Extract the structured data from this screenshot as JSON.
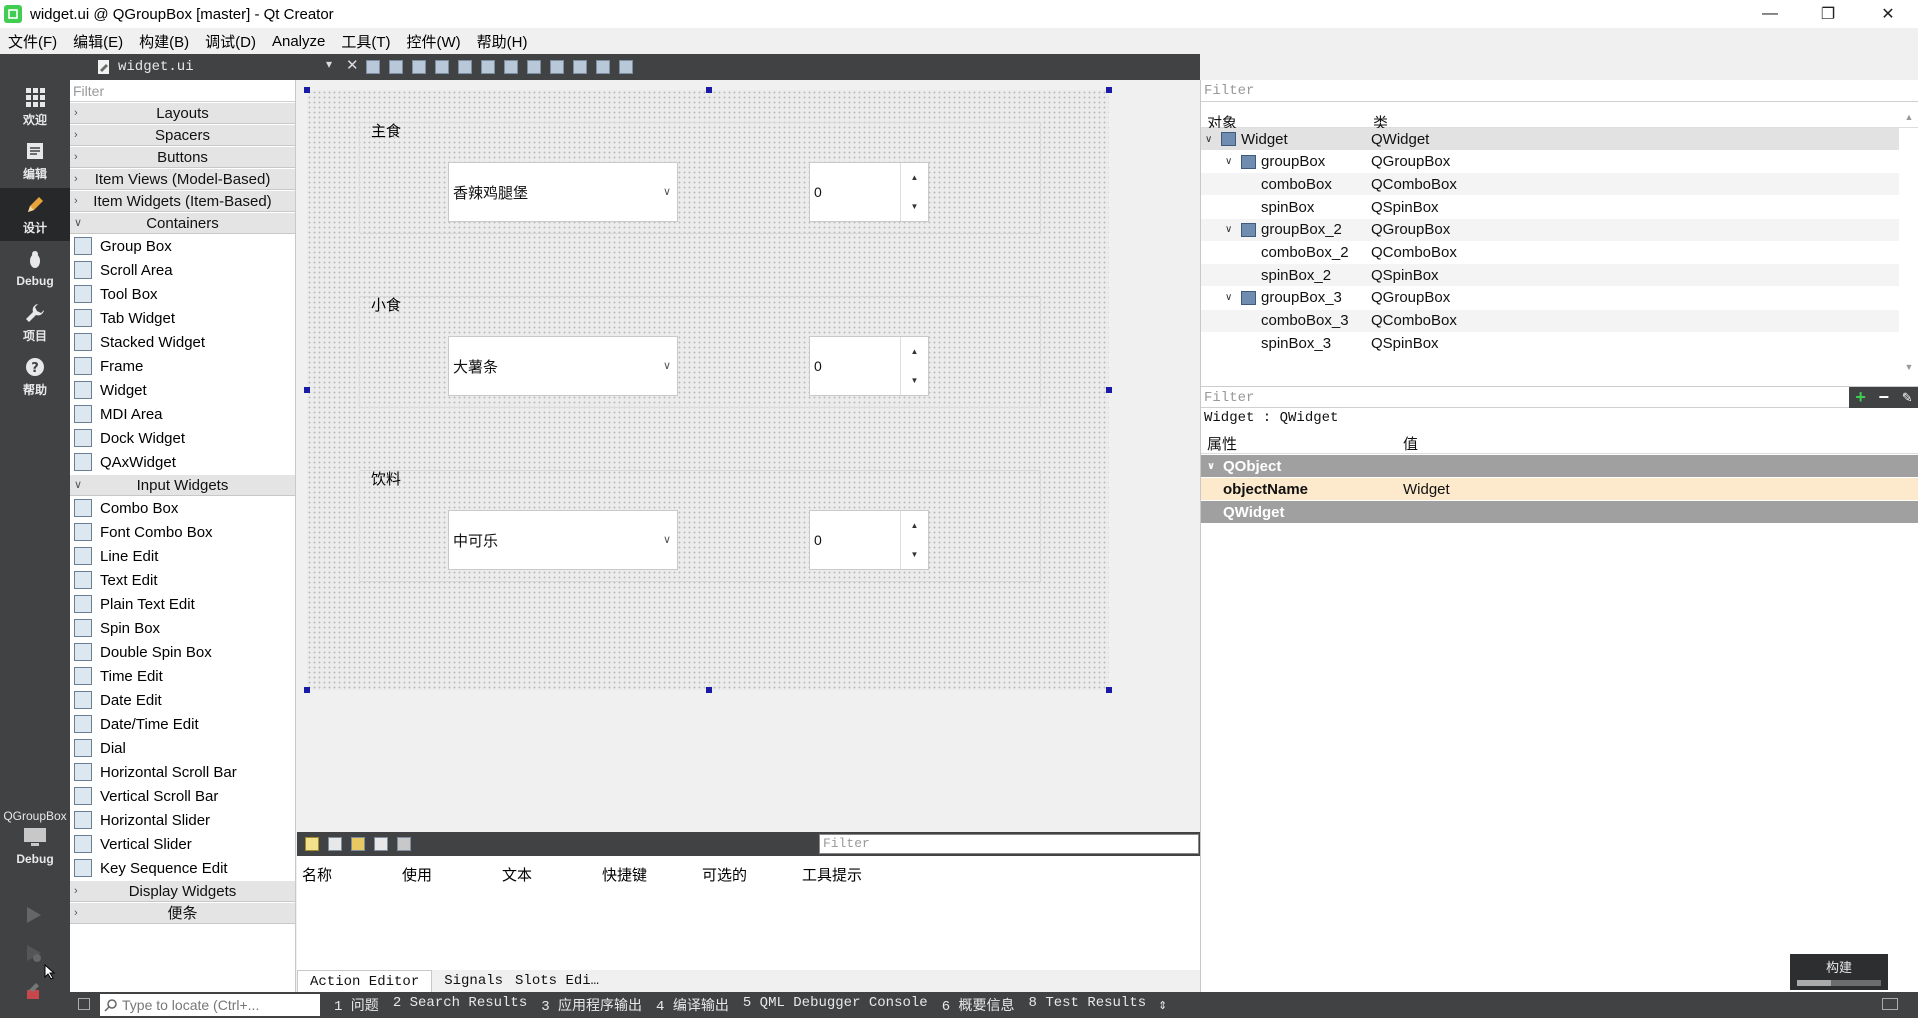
{
  "window": {
    "title": "widget.ui @ QGroupBox [master] - Qt Creator"
  },
  "menu": [
    "文件(F)",
    "编辑(E)",
    "构建(B)",
    "调试(D)",
    "Analyze",
    "工具(T)",
    "控件(W)",
    "帮助(H)"
  ],
  "modes": [
    {
      "label": "欢迎",
      "icon": "grid-icon"
    },
    {
      "label": "编辑",
      "icon": "edit-doc-icon"
    },
    {
      "label": "设计",
      "icon": "pencil-icon"
    },
    {
      "label": "Debug",
      "icon": "bug-icon"
    },
    {
      "label": "项目",
      "icon": "wrench-icon"
    },
    {
      "label": "帮助",
      "icon": "help-icon"
    }
  ],
  "kit": {
    "name": "QGroupBox",
    "mode": "Debug"
  },
  "editor": {
    "file": "widget.ui"
  },
  "widgetbox": {
    "filter_placeholder": "Filter",
    "categories": [
      {
        "name": "Layouts",
        "expanded": false,
        "items": []
      },
      {
        "name": "Spacers",
        "expanded": false,
        "items": []
      },
      {
        "name": "Buttons",
        "expanded": false,
        "items": []
      },
      {
        "name": "Item Views (Model-Based)",
        "expanded": false,
        "items": []
      },
      {
        "name": "Item Widgets (Item-Based)",
        "expanded": false,
        "items": []
      },
      {
        "name": "Containers",
        "expanded": true,
        "items": [
          "Group Box",
          "Scroll Area",
          "Tool Box",
          "Tab Widget",
          "Stacked Widget",
          "Frame",
          "Widget",
          "MDI Area",
          "Dock Widget",
          "QAxWidget"
        ]
      },
      {
        "name": "Input Widgets",
        "expanded": true,
        "items": [
          "Combo Box",
          "Font Combo Box",
          "Line Edit",
          "Text Edit",
          "Plain Text Edit",
          "Spin Box",
          "Double Spin Box",
          "Time Edit",
          "Date Edit",
          "Date/Time Edit",
          "Dial",
          "Horizontal Scroll Bar",
          "Vertical Scroll Bar",
          "Horizontal Slider",
          "Vertical Slider",
          "Key Sequence Edit"
        ]
      },
      {
        "name": "Display Widgets",
        "expanded": false,
        "items": []
      },
      {
        "name": "便条",
        "expanded": false,
        "items": []
      }
    ]
  },
  "form": {
    "groups": [
      {
        "title": "主食",
        "combo": "香辣鸡腿堡",
        "spin": "0"
      },
      {
        "title": "小食",
        "combo": "大薯条",
        "spin": "0"
      },
      {
        "title": "饮料",
        "combo": "中可乐",
        "spin": "0"
      }
    ]
  },
  "action_editor": {
    "filter_placeholder": "Filter",
    "columns": [
      "名称",
      "使用",
      "文本",
      "快捷键",
      "可选的",
      "工具提示"
    ],
    "tabs": [
      "Action Editor",
      "Signals",
      "Slots Edi…"
    ]
  },
  "object_inspector": {
    "filter_placeholder": "Filter",
    "columns": [
      "对象",
      "类"
    ],
    "rows": [
      {
        "name": "Widget",
        "class": "QWidget"
      },
      {
        "name": "groupBox",
        "class": "QGroupBox"
      },
      {
        "name": "comboBox",
        "class": "QComboBox"
      },
      {
        "name": "spinBox",
        "class": "QSpinBox"
      },
      {
        "name": "groupBox_2",
        "class": "QGroupBox"
      },
      {
        "name": "comboBox_2",
        "class": "QComboBox"
      },
      {
        "name": "spinBox_2",
        "class": "QSpinBox"
      },
      {
        "name": "groupBox_3",
        "class": "QGroupBox"
      },
      {
        "name": "comboBox_3",
        "class": "QComboBox"
      },
      {
        "name": "spinBox_3",
        "class": "QSpinBox"
      }
    ]
  },
  "property_editor": {
    "filter_placeholder": "Filter",
    "object_label": "Widget : QWidget",
    "columns": [
      "属性",
      "值"
    ],
    "rows": [
      {
        "name": "QObject",
        "value": ""
      },
      {
        "name": "objectName",
        "value": "Widget"
      },
      {
        "name": "QWidget",
        "value": ""
      }
    ]
  },
  "statusbar": {
    "locator_placeholder": "Type to locate (Ctrl+...",
    "panes": [
      "1 问题",
      "2 Search Results",
      "3 应用程序输出",
      "4 编译输出",
      "5 QML Debugger Console",
      "6 概要信息",
      "8 Test Results"
    ]
  },
  "build": {
    "label": "构建",
    "progress": 0.4
  },
  "colors": {
    "accent": "#41cd52",
    "sidebar": "#404244",
    "handle": "#1a1aa8",
    "highlight": "#fde9cc"
  }
}
